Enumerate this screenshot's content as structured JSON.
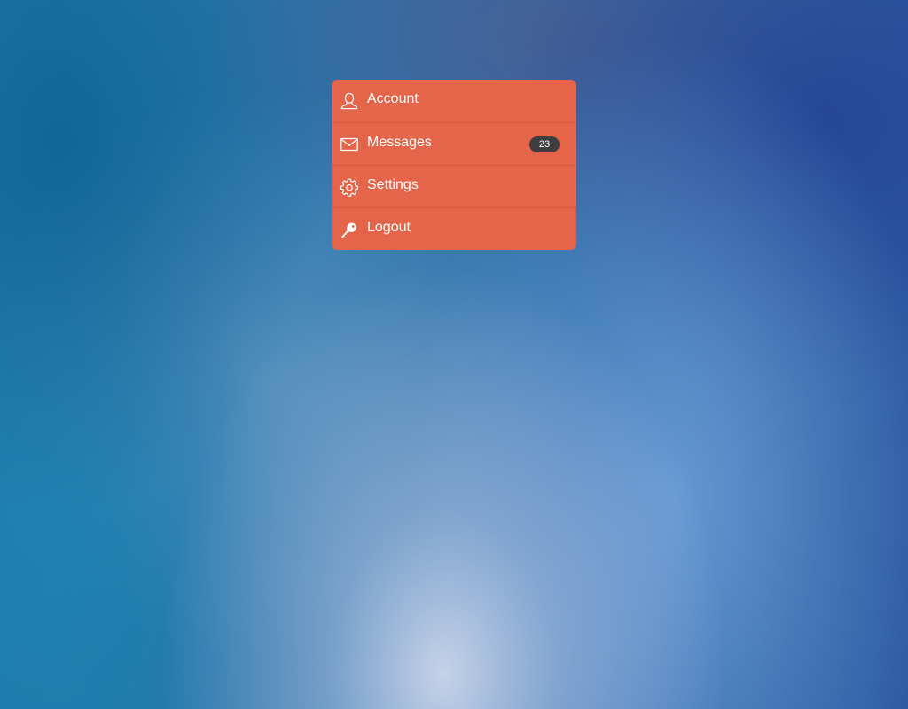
{
  "colors": {
    "menu_background": "#e4654a",
    "menu_text": "#ffffff",
    "badge_background": "#3e3d3f",
    "badge_text": "#ffffff"
  },
  "menu": {
    "items": [
      {
        "label": "Account",
        "icon": "user-icon"
      },
      {
        "label": "Messages",
        "icon": "mail-icon",
        "badge": "23"
      },
      {
        "label": "Settings",
        "icon": "gear-icon"
      },
      {
        "label": "Logout",
        "icon": "key-icon"
      }
    ]
  }
}
